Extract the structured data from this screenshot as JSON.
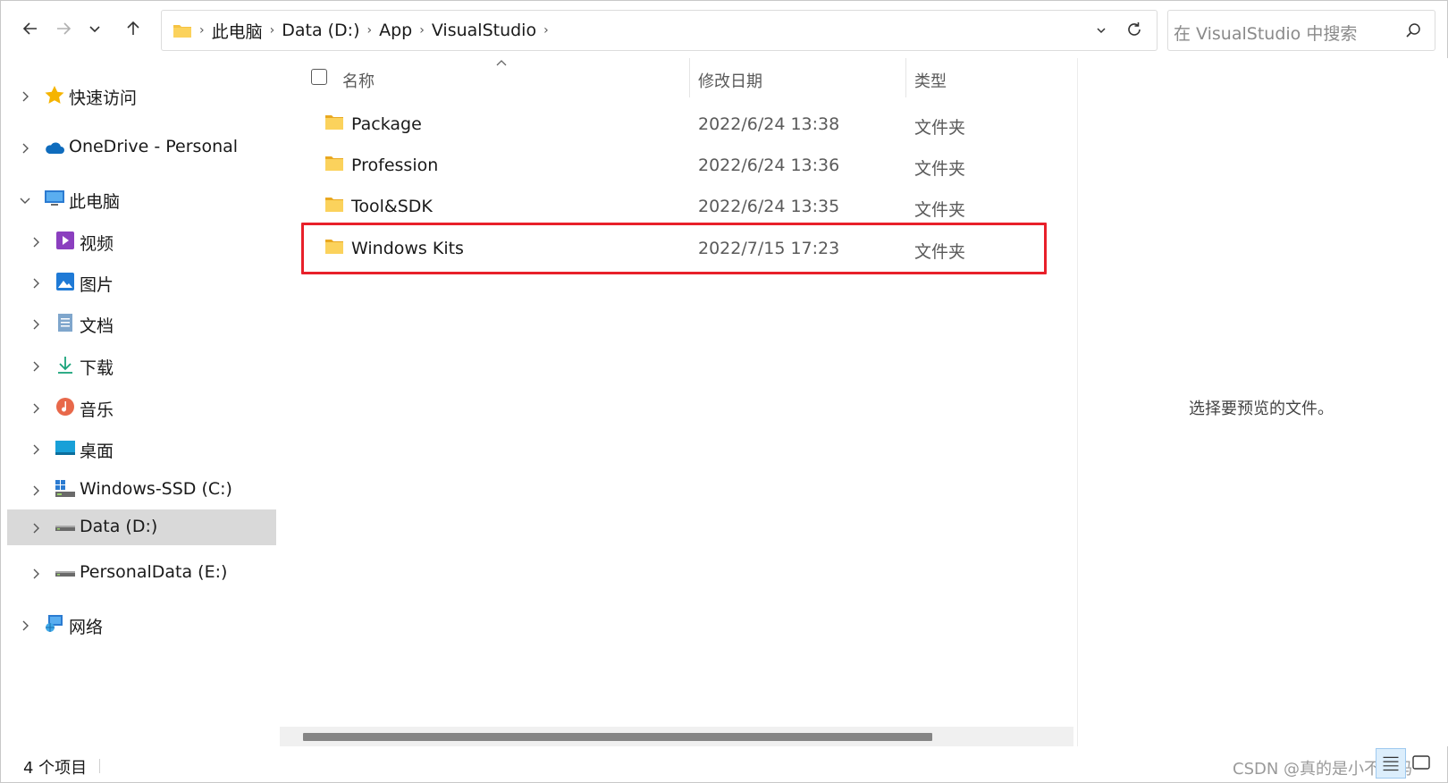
{
  "toolbar": {
    "back_icon": "arrow-left-icon",
    "forward_icon": "arrow-right-icon",
    "recent_icon": "chevron-down-icon",
    "up_icon": "arrow-up-icon"
  },
  "address": {
    "crumbs": [
      "此电脑",
      "Data (D:)",
      "App",
      "VisualStudio"
    ],
    "separator": "›"
  },
  "search": {
    "placeholder": "在 VisualStudio 中搜索"
  },
  "sidebar": {
    "items": [
      {
        "label": "快速访问",
        "icon": "star-icon"
      },
      {
        "label": "OneDrive - Personal",
        "icon": "cloud-icon"
      },
      {
        "label": "此电脑",
        "icon": "computer-icon"
      },
      {
        "label": "视频",
        "icon": "video-icon"
      },
      {
        "label": "图片",
        "icon": "pictures-icon"
      },
      {
        "label": "文档",
        "icon": "document-icon"
      },
      {
        "label": "下载",
        "icon": "download-icon"
      },
      {
        "label": "音乐",
        "icon": "music-icon"
      },
      {
        "label": "桌面",
        "icon": "desktop-icon"
      },
      {
        "label": "Windows-SSD (C:)",
        "icon": "system-drive-icon"
      },
      {
        "label": "Data (D:)",
        "icon": "drive-icon"
      },
      {
        "label": "PersonalData (E:)",
        "icon": "drive-icon"
      },
      {
        "label": "网络",
        "icon": "network-icon"
      }
    ],
    "selected": "Data (D:)"
  },
  "columns": {
    "name": "名称",
    "date": "修改日期",
    "type": "类型"
  },
  "files": [
    {
      "name": "Package",
      "date": "2022/6/24 13:38",
      "type": "文件夹"
    },
    {
      "name": "Profession",
      "date": "2022/6/24 13:36",
      "type": "文件夹"
    },
    {
      "name": "Tool&SDK",
      "date": "2022/6/24 13:35",
      "type": "文件夹"
    },
    {
      "name": "Windows Kits",
      "date": "2022/7/15 17:23",
      "type": "文件夹"
    }
  ],
  "highlighted_file": "Windows Kits",
  "preview": {
    "message": "选择要预览的文件。"
  },
  "status": {
    "item_count": "4 个项目"
  },
  "watermark": "CSDN @真的是小不点吗",
  "colors": {
    "highlight": "#e8202a",
    "folder": "#f6c342",
    "selected_bg": "#d9d9d9"
  }
}
